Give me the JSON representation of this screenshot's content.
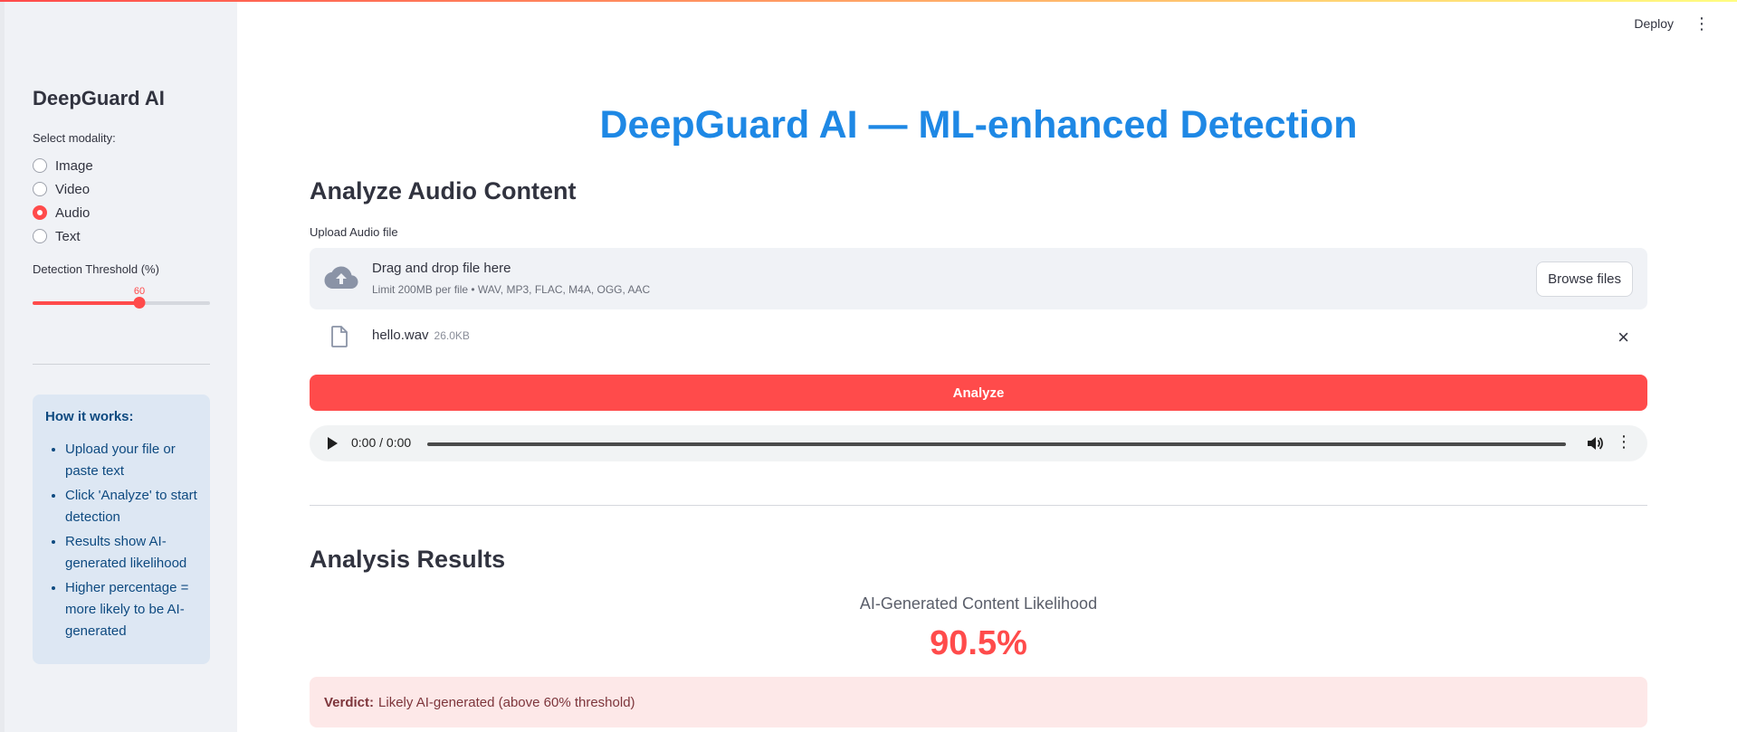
{
  "header": {
    "deploy_label": "Deploy",
    "menu_icon": "kebab-menu-icon"
  },
  "sidebar": {
    "title": "DeepGuard AI",
    "modality_label": "Select modality:",
    "modalities": [
      {
        "label": "Image",
        "selected": false
      },
      {
        "label": "Video",
        "selected": false
      },
      {
        "label": "Audio",
        "selected": true
      },
      {
        "label": "Text",
        "selected": false
      }
    ],
    "threshold_label": "Detection Threshold (%)",
    "threshold_value": "60",
    "threshold_fraction": 0.6,
    "info": {
      "title": "How it works:",
      "items": [
        "Upload your file or paste text",
        "Click 'Analyze' to start detection",
        "Results show AI-generated likelihood",
        "Higher percentage = more likely to be AI-generated"
      ]
    }
  },
  "main": {
    "title": "DeepGuard AI — ML-enhanced Detection",
    "section_title": "Analyze Audio Content",
    "upload_label": "Upload Audio file",
    "dropzone": {
      "main_text": "Drag and drop file here",
      "sub_text": "Limit 200MB per file • WAV, MP3, FLAC, M4A, OGG, AAC",
      "browse_label": "Browse files"
    },
    "file": {
      "name": "hello.wav",
      "size": "26.0KB"
    },
    "analyze_label": "Analyze",
    "player": {
      "time": "0:00 / 0:00"
    },
    "results_title": "Analysis Results",
    "metric_label": "AI-Generated Content Likelihood",
    "metric_value": "90.5%",
    "verdict_label": "Verdict:",
    "verdict_text": "Likely AI-generated (above 60% threshold)"
  },
  "colors": {
    "accent": "#ff4b4b",
    "title_blue": "#1e88e5",
    "info_bg": "#dde7f3",
    "verdict_bg": "#fde8e8"
  }
}
